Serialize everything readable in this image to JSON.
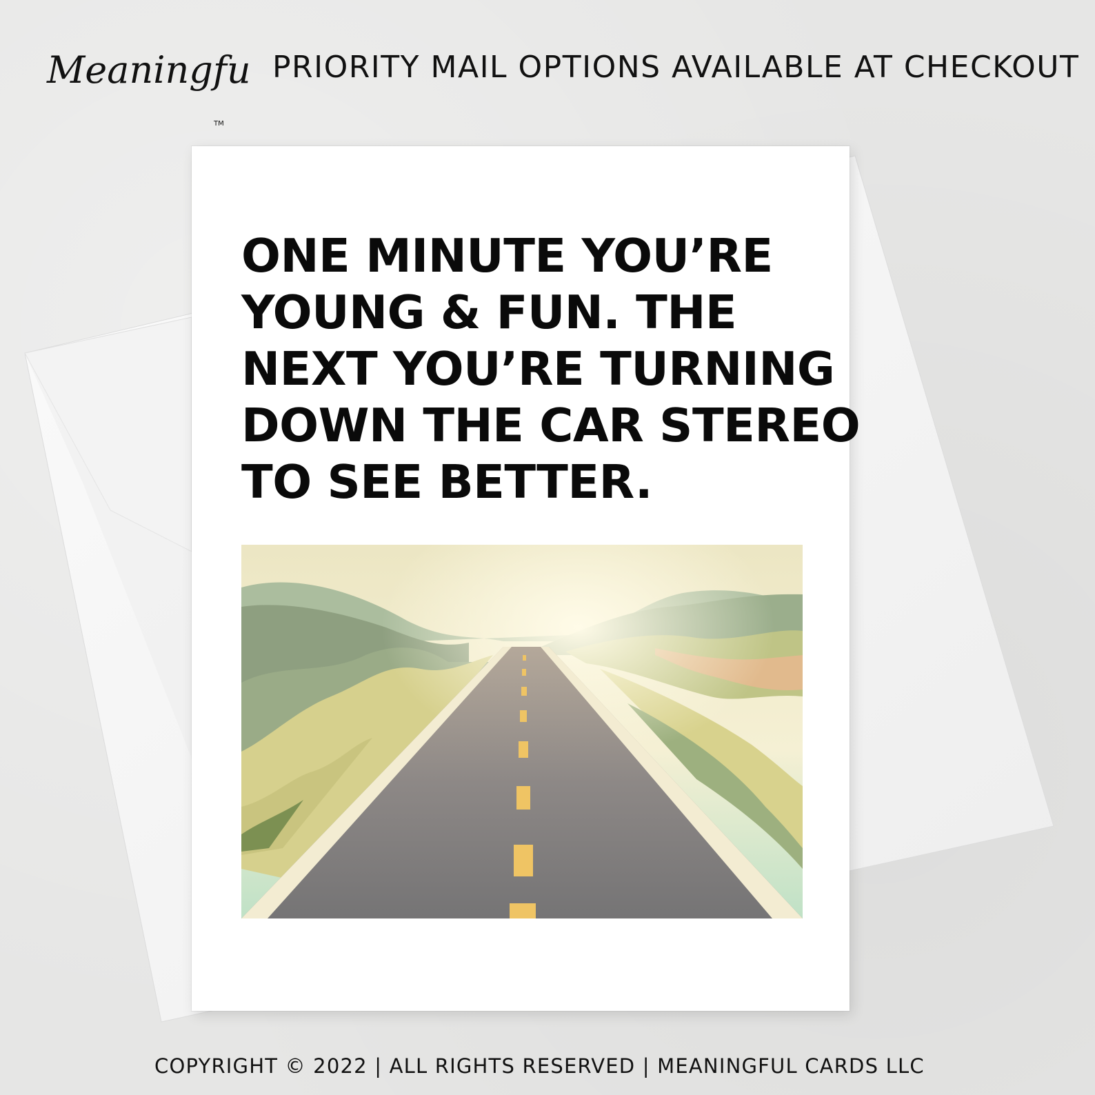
{
  "brand": {
    "logo_text": "Meaningful Cards",
    "logo_mark": "TM"
  },
  "banner": {
    "text": "PRIORITY MAIL OPTIONS AVAILABLE AT CHECKOUT"
  },
  "card": {
    "lines": [
      "ONE MINUTE YOU’RE",
      "YOUNG & FUN. THE",
      "NEXT YOU’RE TURNING",
      "DOWN THE CAR STEREO",
      "TO SEE BETTER."
    ],
    "illustration_icon": "open-road-icon"
  },
  "footer": {
    "text": "COPYRIGHT © 2022 | ALL RIGHTS RESERVED | MEANINGFUL CARDS LLC"
  },
  "colors": {
    "background": "#e6e6e5",
    "card": "#ffffff",
    "envelope": "#f7f7f7",
    "road": "#7a7878",
    "center_line": "#efc464",
    "edge_line": "#f3ecd2",
    "hills_dark": "#8c9f74",
    "hills_light": "#d9d490"
  }
}
